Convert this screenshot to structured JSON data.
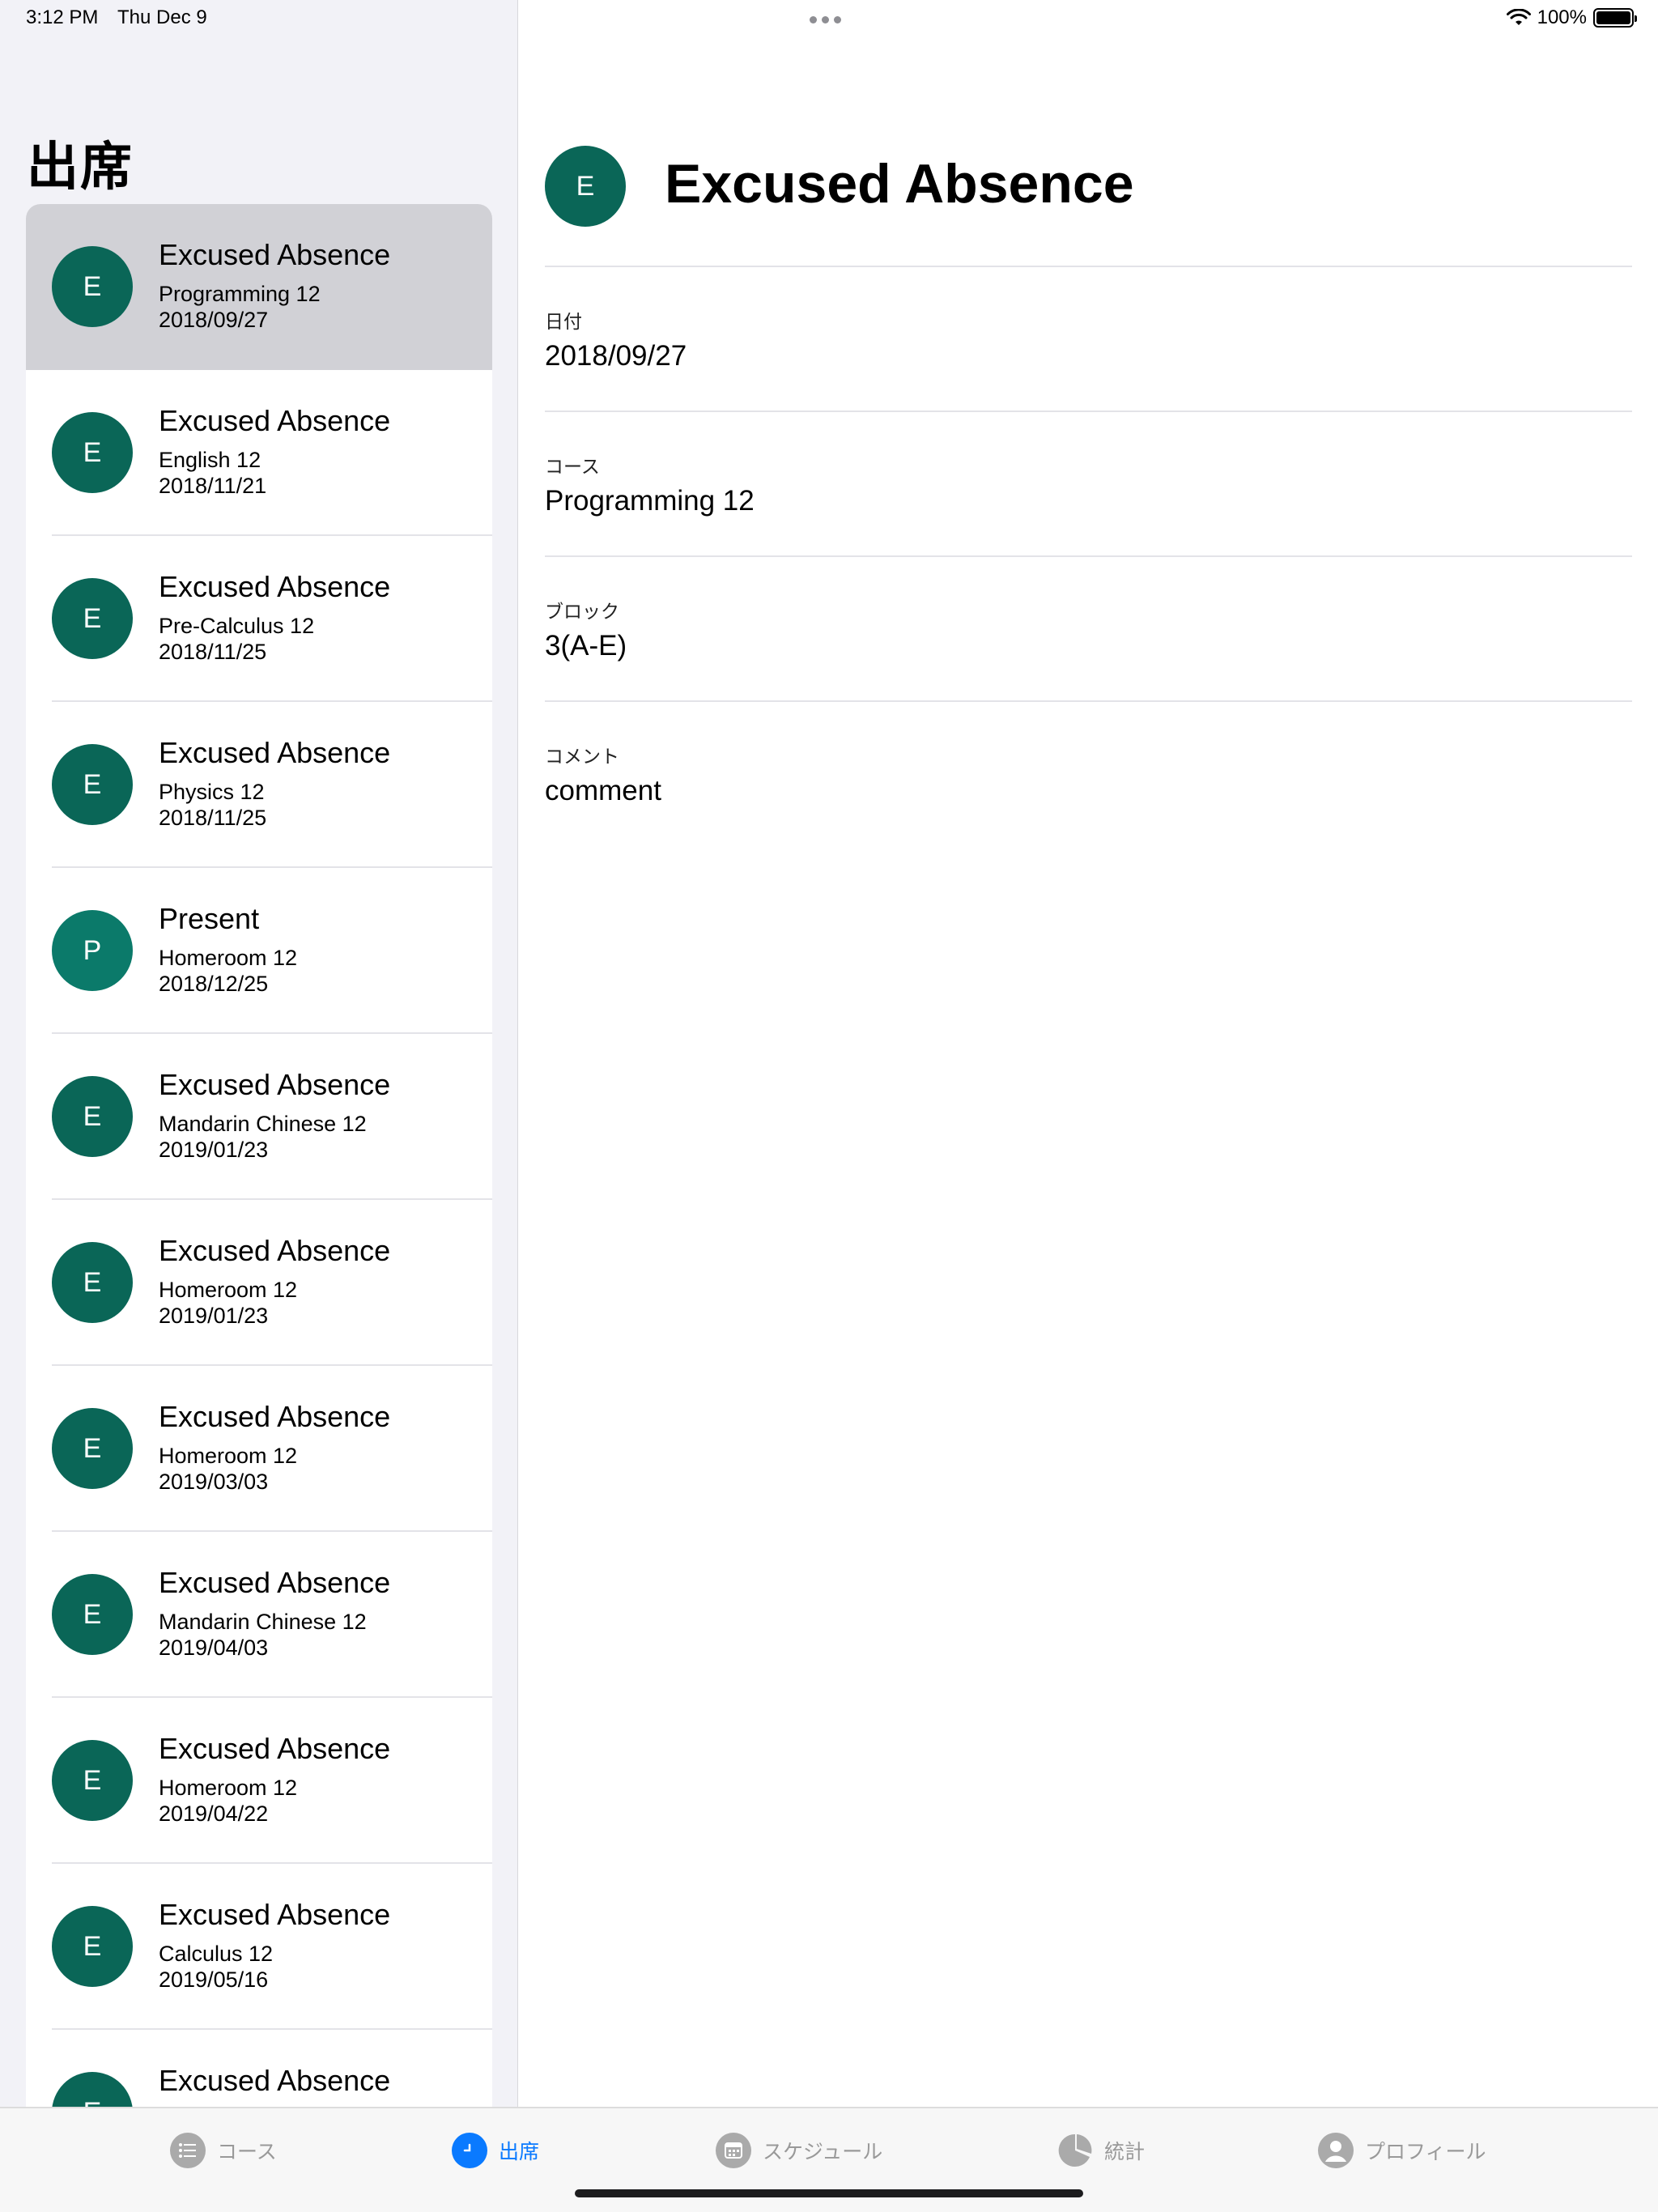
{
  "status_bar": {
    "time": "3:12 PM",
    "date": "Thu Dec 9",
    "battery": "100%"
  },
  "sidebar": {
    "title": "出席",
    "items": [
      {
        "initial": "E",
        "status": "Excused Absence",
        "course": "Programming 12",
        "date": "2018/09/27"
      },
      {
        "initial": "E",
        "status": "Excused Absence",
        "course": "English 12",
        "date": "2018/11/21"
      },
      {
        "initial": "E",
        "status": "Excused Absence",
        "course": "Pre-Calculus 12",
        "date": "2018/11/25"
      },
      {
        "initial": "E",
        "status": "Excused Absence",
        "course": "Physics 12",
        "date": "2018/11/25"
      },
      {
        "initial": "P",
        "status": "Present",
        "course": "Homeroom 12",
        "date": "2018/12/25"
      },
      {
        "initial": "E",
        "status": "Excused Absence",
        "course": "Mandarin Chinese 12",
        "date": "2019/01/23"
      },
      {
        "initial": "E",
        "status": "Excused Absence",
        "course": "Homeroom 12",
        "date": "2019/01/23"
      },
      {
        "initial": "E",
        "status": "Excused Absence",
        "course": "Homeroom 12",
        "date": "2019/03/03"
      },
      {
        "initial": "E",
        "status": "Excused Absence",
        "course": "Mandarin Chinese 12",
        "date": "2019/04/03"
      },
      {
        "initial": "E",
        "status": "Excused Absence",
        "course": "Homeroom 12",
        "date": "2019/04/22"
      },
      {
        "initial": "E",
        "status": "Excused Absence",
        "course": "Calculus 12",
        "date": "2019/05/16"
      },
      {
        "initial": "E",
        "status": "Excused Absence",
        "course": "",
        "date": ""
      }
    ]
  },
  "detail": {
    "initial": "E",
    "title": "Excused Absence",
    "fields": [
      {
        "label": "日付",
        "value": "2018/09/27"
      },
      {
        "label": "コース",
        "value": "Programming 12"
      },
      {
        "label": "ブロック",
        "value": "3(A-E)"
      },
      {
        "label": "コメント",
        "value": "comment"
      }
    ]
  },
  "tabs": [
    {
      "label": "コース",
      "icon": "list-icon"
    },
    {
      "label": "出席",
      "icon": "clock-icon",
      "active": true
    },
    {
      "label": "スケジュール",
      "icon": "calendar-icon"
    },
    {
      "label": "統計",
      "icon": "pie-chart-icon"
    },
    {
      "label": "プロフィール",
      "icon": "person-icon"
    }
  ],
  "colors": {
    "accent": "#0a7aff",
    "avatar": "#0a6657",
    "selected": "#d1d1d6"
  }
}
